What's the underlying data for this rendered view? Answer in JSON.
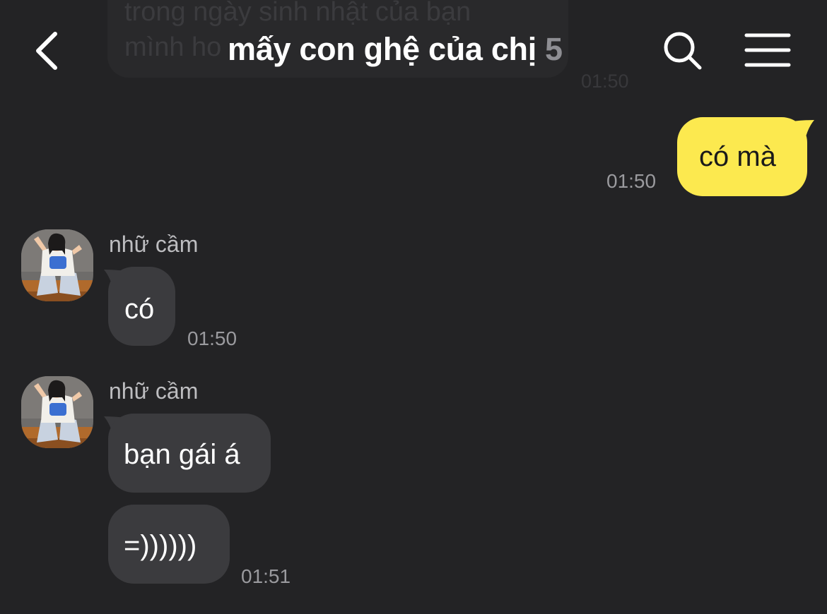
{
  "header": {
    "title": "mấy con ghệ của chị",
    "member_count": "5"
  },
  "previous_message": {
    "text": "trong ngày sinh nhật của bạn\nmình ho",
    "time": "01:50"
  },
  "messages": [
    {
      "from": "me",
      "text": "có mà",
      "time": "01:50"
    },
    {
      "from": "nhữ cầm",
      "sender": "nhữ cầm",
      "text": "có",
      "time": "01:50"
    },
    {
      "from": "nhữ cầm",
      "sender": "nhữ cầm",
      "text": "bạn gái á",
      "time": ""
    },
    {
      "from": "nhữ cầm",
      "text": "=))))))",
      "time": "01:51"
    }
  ],
  "colors": {
    "background": "#232325",
    "my_bubble": "#fce94f",
    "their_bubble": "#3b3b3e",
    "timestamp": "#9a9a9e"
  },
  "icons": {
    "back": "chevron-left-icon",
    "search": "search-icon",
    "menu": "hamburger-menu-icon"
  }
}
